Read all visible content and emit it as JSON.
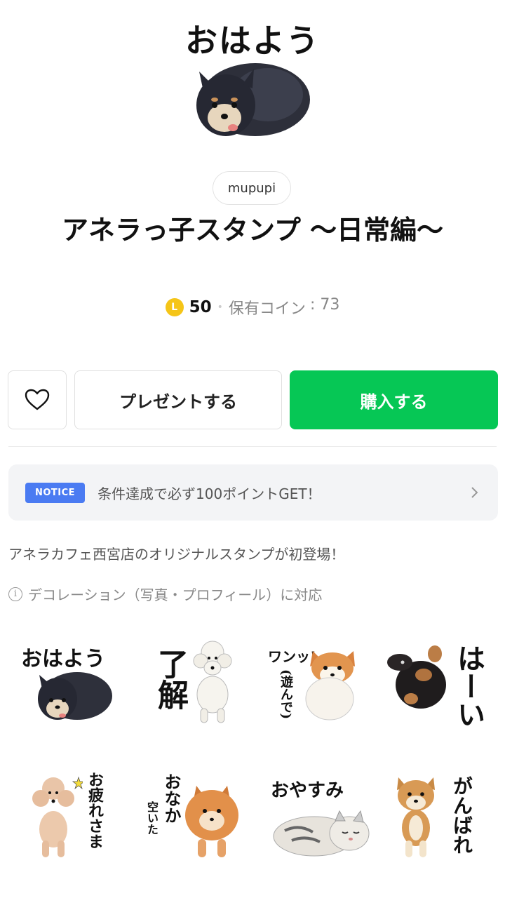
{
  "hero": {
    "caption": "おはよう"
  },
  "author": "mupupi",
  "title": "アネラっ子スタンプ 〜日常編〜",
  "price": {
    "coin_symbol": "L",
    "value": "50",
    "owned_label": "保有コイン",
    "owned_value": ": 73"
  },
  "buttons": {
    "present": "プレゼントする",
    "buy": "購入する",
    "buy_color": "#06c755"
  },
  "notice": {
    "badge": "NOTICE",
    "text": "条件達成で必ず100ポイントGET！"
  },
  "description": "アネラカフェ西宮店のオリジナルスタンプが初登場！",
  "decoration_note": "デコレーション（写真・プロフィール）に対応",
  "stickers": [
    {
      "label": "おはよう",
      "dog": "pomeranian-black"
    },
    {
      "label": "了解",
      "dog": "poodle-white"
    },
    {
      "label": "ワンッ!",
      "sub": "(遊んで)",
      "dog": "pomeranian-corgi"
    },
    {
      "label": "はーい",
      "dog": "dachshund-black"
    },
    {
      "label": "お疲れさま",
      "dog": "poodle-apricot"
    },
    {
      "label": "おなか",
      "sub": "空いた",
      "dog": "pomeranian-orange"
    },
    {
      "label": "おやすみ",
      "dog": "cat-tabby"
    },
    {
      "label": "がんばれ",
      "dog": "shiba"
    }
  ]
}
